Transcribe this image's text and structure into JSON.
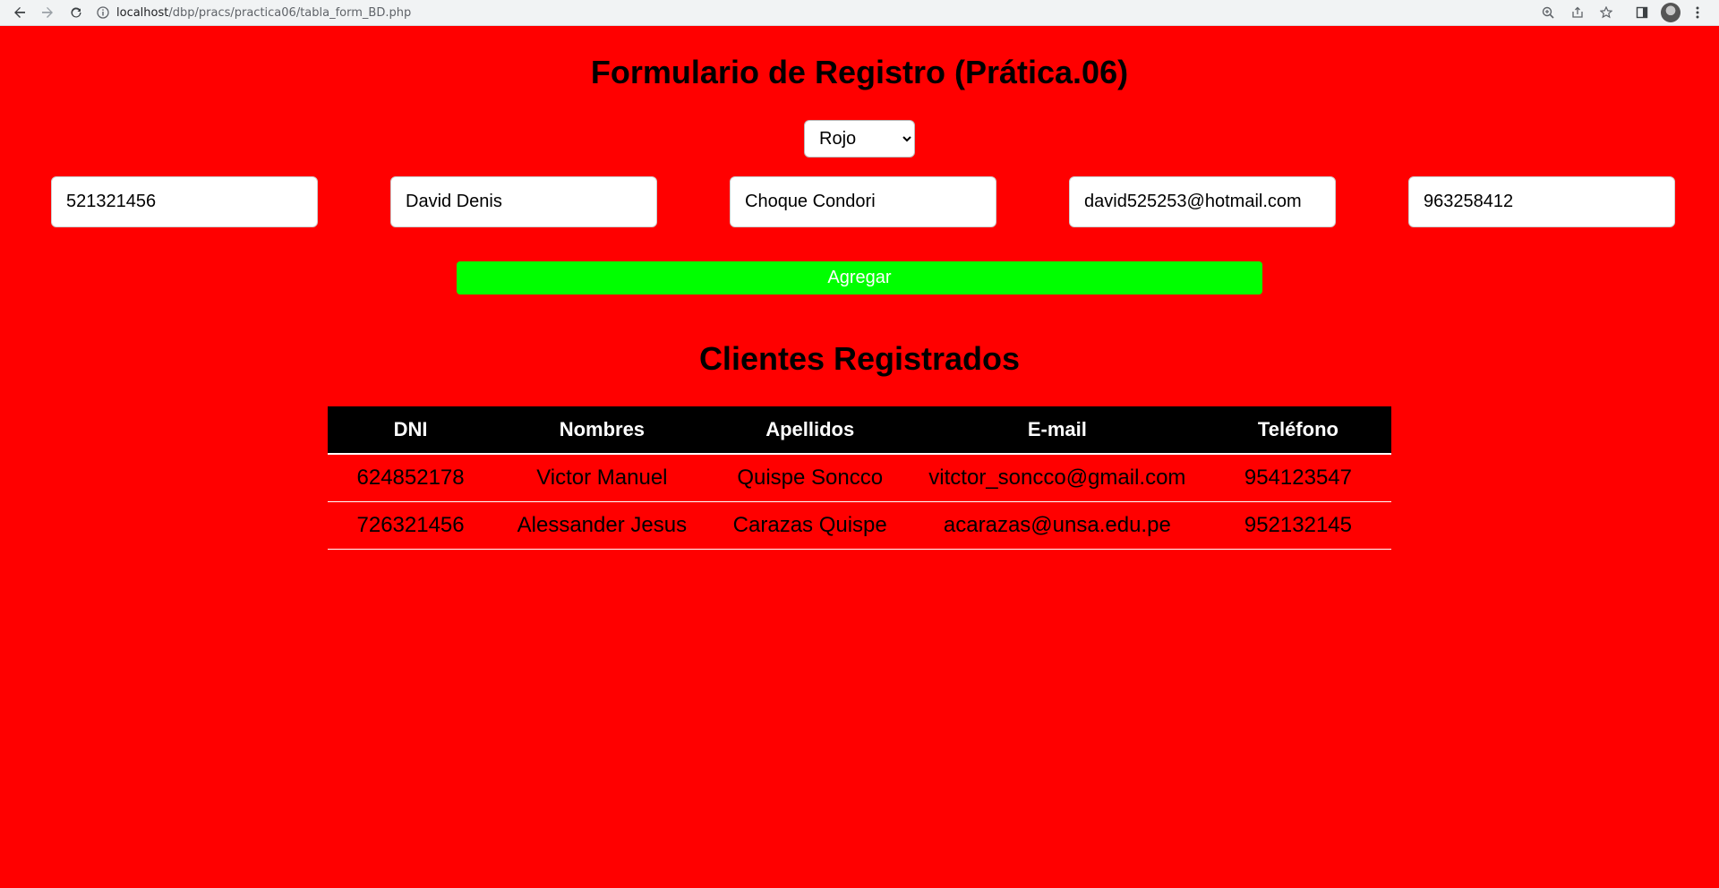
{
  "browser": {
    "url_host": "localhost",
    "url_path": "/dbp/pracs/practica06/tabla_form_BD.php"
  },
  "page": {
    "title": "Formulario de Registro (Prática.06)",
    "background_color": "#ff0000"
  },
  "form": {
    "color_select": {
      "selected": "Rojo"
    },
    "fields": {
      "dni": "521321456",
      "nombres": "David Denis",
      "apellidos": "Choque Condori",
      "email": "david525253@hotmail.com",
      "telefono": "963258412"
    },
    "add_button_label": "Agregar",
    "add_button_color": "#00ff00"
  },
  "clients": {
    "title": "Clientes Registrados",
    "columns": [
      "DNI",
      "Nombres",
      "Apellidos",
      "E-mail",
      "Teléfono"
    ],
    "rows": [
      [
        "624852178",
        "Victor Manuel",
        "Quispe Soncco",
        "vitctor_soncco@gmail.com",
        "954123547"
      ],
      [
        "726321456",
        "Alessander Jesus",
        "Carazas Quispe",
        "acarazas@unsa.edu.pe",
        "952132145"
      ]
    ]
  }
}
